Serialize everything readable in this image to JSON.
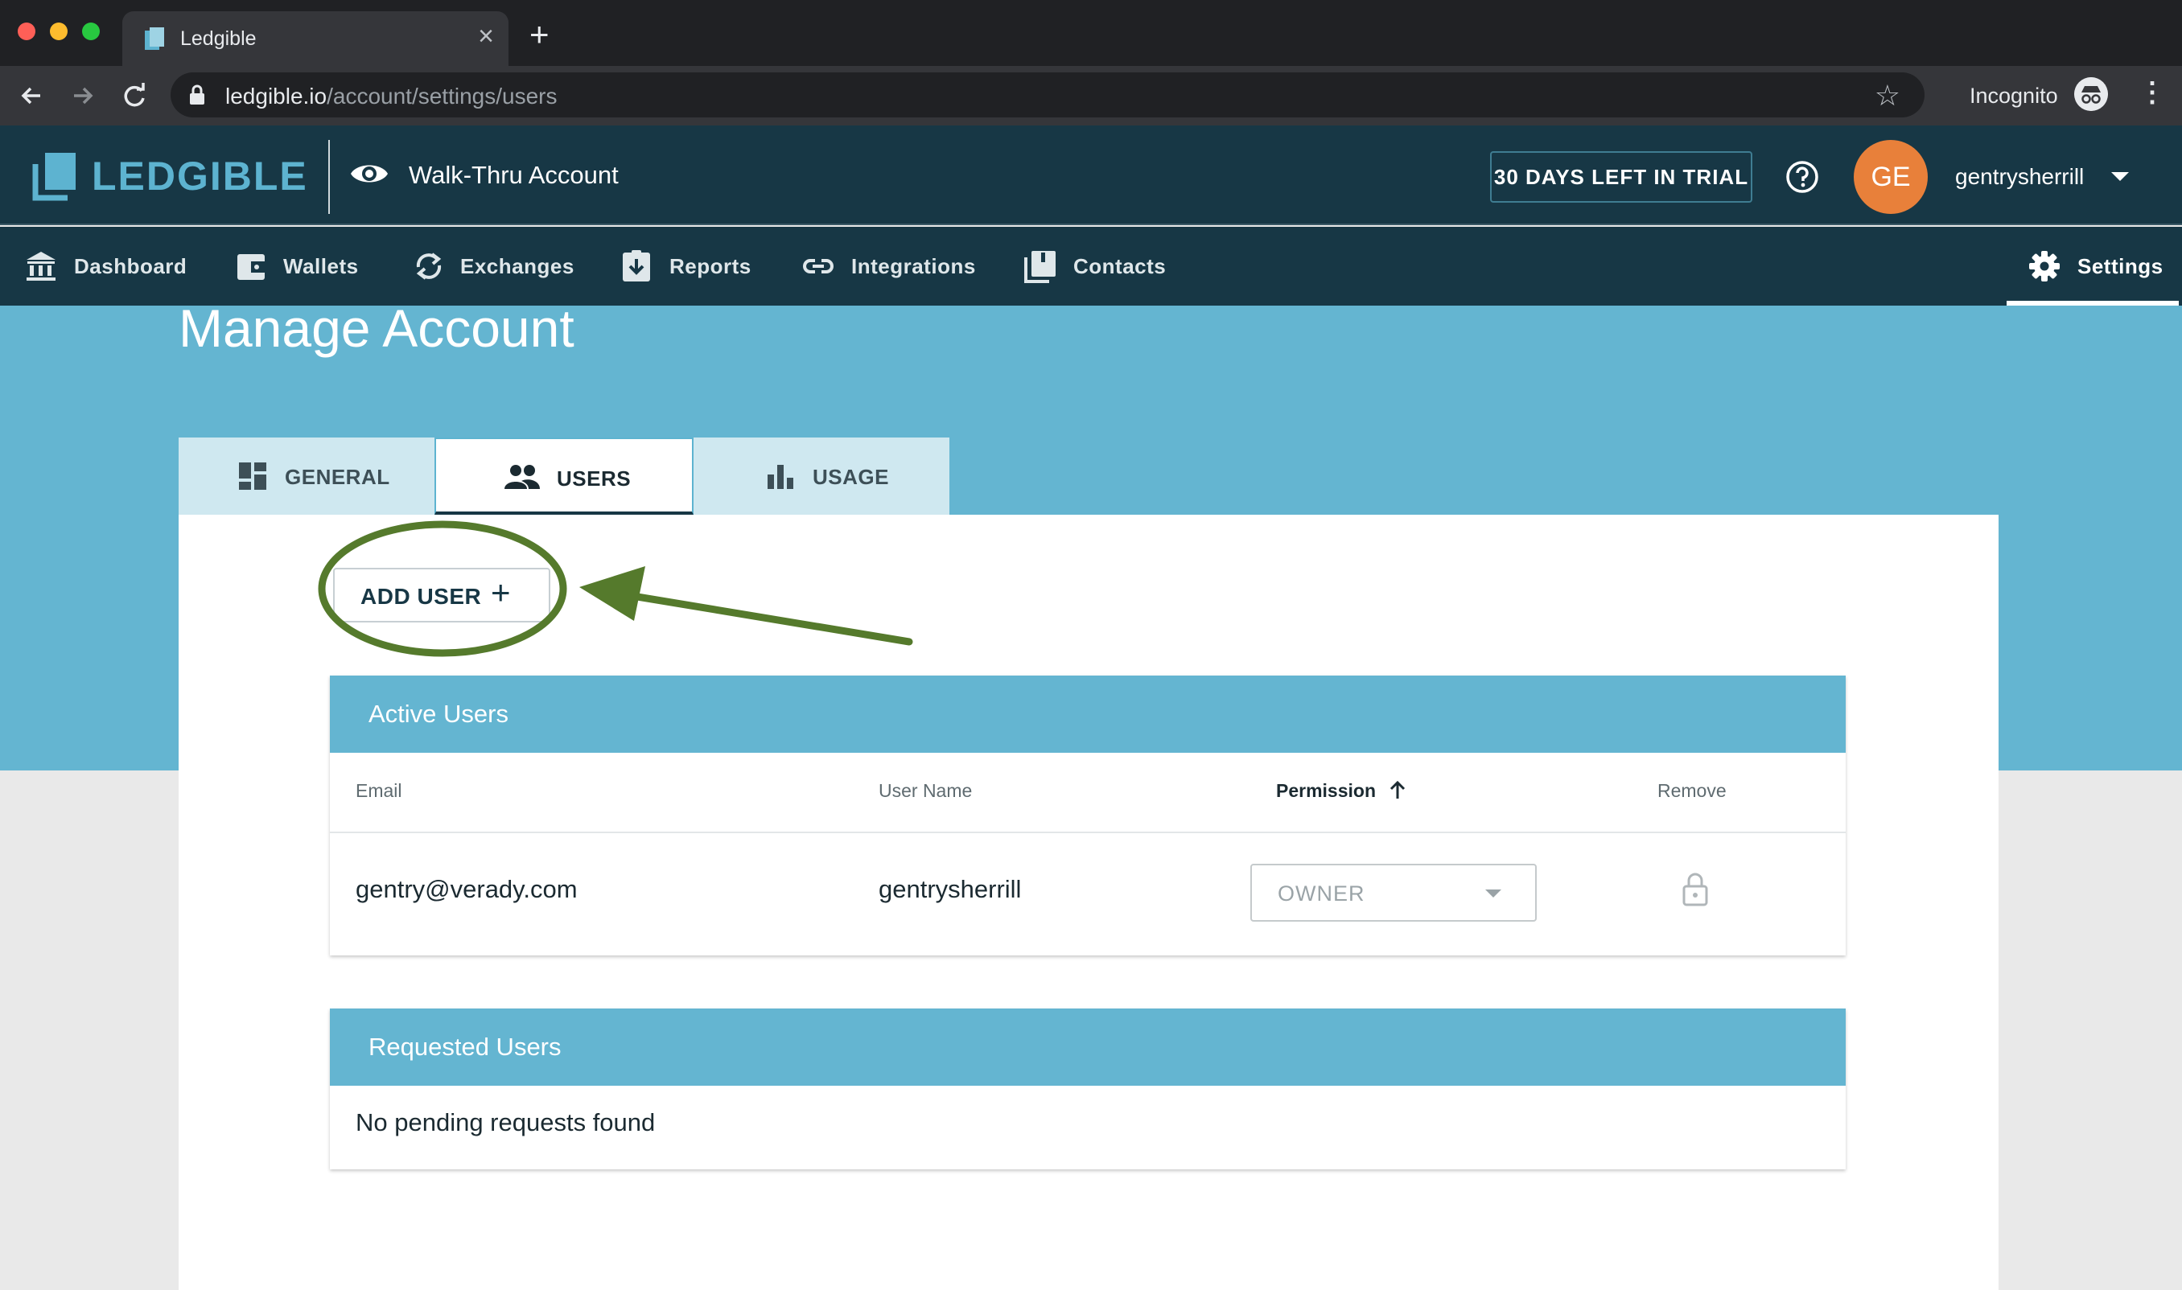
{
  "browser": {
    "tab_title": "Ledgible",
    "url_host": "ledgible.io",
    "url_path": "/account/settings/users",
    "mode_label": "Incognito"
  },
  "header": {
    "logo_text": "LEDGIBLE",
    "account_name": "Walk-Thru Account",
    "trial_label": "30 DAYS LEFT IN TRIAL",
    "avatar_initials": "GE",
    "user_name": "gentrysherrill",
    "avatar_color": "#e8803a"
  },
  "nav": {
    "items": [
      {
        "label": "Dashboard",
        "icon": "bank-icon"
      },
      {
        "label": "Wallets",
        "icon": "wallet-icon"
      },
      {
        "label": "Exchanges",
        "icon": "sync-icon"
      },
      {
        "label": "Reports",
        "icon": "download-report-icon"
      },
      {
        "label": "Integrations",
        "icon": "link-icon"
      },
      {
        "label": "Contacts",
        "icon": "contacts-book-icon"
      }
    ],
    "settings_label": "Settings",
    "active": "Settings"
  },
  "page": {
    "title": "Manage Account",
    "tabs": [
      {
        "label": "GENERAL",
        "icon": "dashboard-grid-icon"
      },
      {
        "label": "USERS",
        "icon": "people-icon"
      },
      {
        "label": "USAGE",
        "icon": "bar-chart-icon"
      }
    ],
    "active_tab": "USERS",
    "add_user_label": "ADD USER",
    "add_user_icon": "plus-icon"
  },
  "active_users": {
    "title": "Active Users",
    "columns": {
      "email": "Email",
      "user_name": "User Name",
      "permission": "Permission",
      "remove": "Remove"
    },
    "sort": "Permission ascending",
    "rows": [
      {
        "email": "gentry@verady.com",
        "user_name": "gentrysherrill",
        "permission": "OWNER",
        "remove_icon": "lock-icon"
      }
    ]
  },
  "requested_users": {
    "title": "Requested Users",
    "empty_text": "No pending requests found"
  },
  "colors": {
    "brand_dark": "#173745",
    "brand_blue": "#64b5d1",
    "annotation_green": "#557a2c"
  }
}
